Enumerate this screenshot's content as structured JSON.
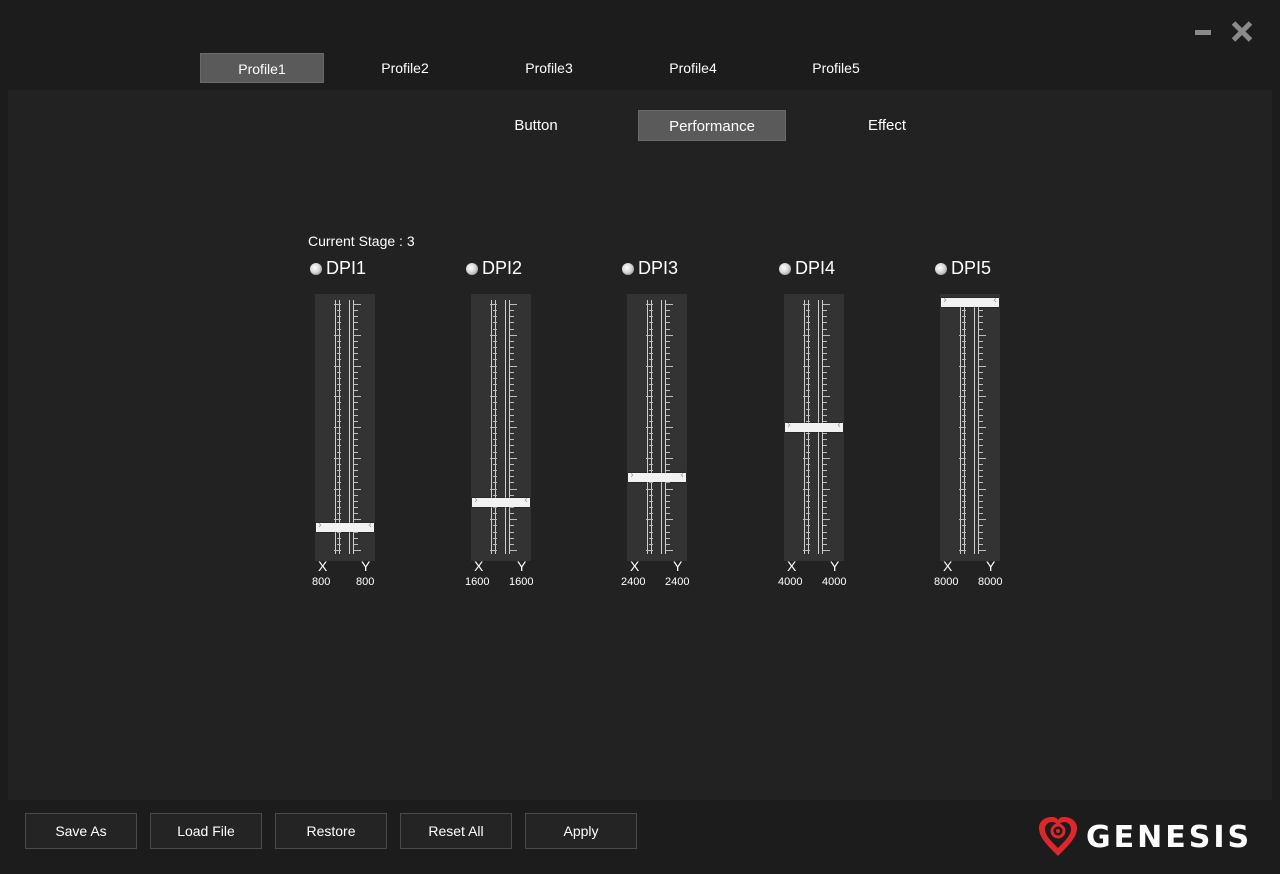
{
  "window": {
    "minimize_icon": "minimize-icon",
    "close_icon": "close-icon"
  },
  "profiles": [
    {
      "label": "Profile1",
      "active": true
    },
    {
      "label": "Profile2",
      "active": false
    },
    {
      "label": "Profile3",
      "active": false
    },
    {
      "label": "Profile4",
      "active": false
    },
    {
      "label": "Profile5",
      "active": false
    }
  ],
  "subtabs": [
    {
      "label": "Button",
      "active": false
    },
    {
      "label": "Performance",
      "active": true
    },
    {
      "label": "Effect",
      "active": false
    }
  ],
  "performance": {
    "current_stage": "Current Stage : 3",
    "axis_x": "X",
    "axis_y": "Y",
    "dpi_max": 8000,
    "dpi_min": 0,
    "stages": [
      {
        "label": "DPI1",
        "x": "800",
        "y": "800",
        "value": 800
      },
      {
        "label": "DPI2",
        "x": "1600",
        "y": "1600",
        "value": 1600
      },
      {
        "label": "DPI3",
        "x": "2400",
        "y": "2400",
        "value": 2400
      },
      {
        "label": "DPI4",
        "x": "4000",
        "y": "4000",
        "value": 4000
      },
      {
        "label": "DPI5",
        "x": "8000",
        "y": "8000",
        "value": 8000
      }
    ]
  },
  "buttons": {
    "save_as": "Save As",
    "load_file": "Load File",
    "restore": "Restore",
    "reset_all": "Reset All",
    "apply": "Apply"
  },
  "brand": {
    "name": "GENESIS",
    "accent": "#e0262b"
  }
}
